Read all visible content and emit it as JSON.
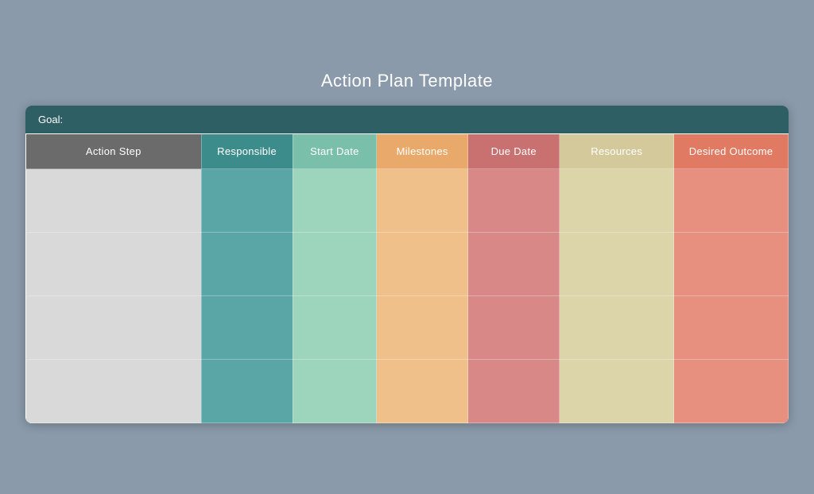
{
  "page": {
    "title": "Action Plan Template"
  },
  "goal_bar": {
    "label": "Goal:"
  },
  "columns": [
    {
      "id": "action-step",
      "label": "Action Step",
      "class": "col-action-step"
    },
    {
      "id": "responsible",
      "label": "Responsible",
      "class": "col-responsible"
    },
    {
      "id": "start-date",
      "label": "Start Date",
      "class": "col-start-date"
    },
    {
      "id": "milestones",
      "label": "Milestones",
      "class": "col-milestones"
    },
    {
      "id": "due-date",
      "label": "Due Date",
      "class": "col-due-date"
    },
    {
      "id": "resources",
      "label": "Resources",
      "class": "col-resources"
    },
    {
      "id": "desired-outcome",
      "label": "Desired Outcome",
      "class": "col-desired-outcome"
    }
  ],
  "rows": [
    {
      "id": "row-1"
    },
    {
      "id": "row-2"
    },
    {
      "id": "row-3"
    },
    {
      "id": "row-4"
    }
  ]
}
